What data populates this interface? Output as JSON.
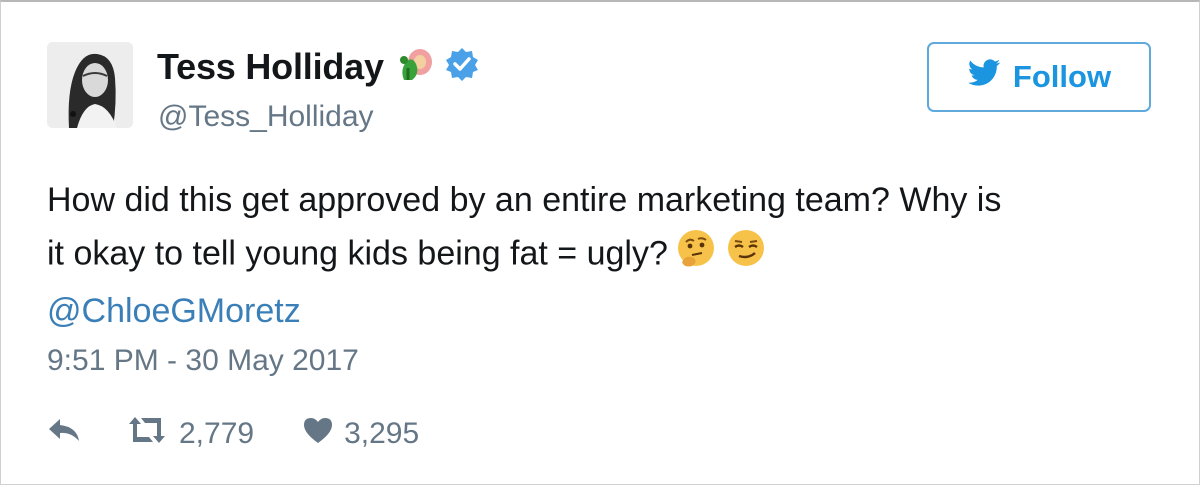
{
  "tweet": {
    "author": {
      "display_name": "Tess Holliday",
      "handle": "@Tess_Holliday",
      "name_emoji": "tiger/flower emoji",
      "verified": true
    },
    "follow_label": "Follow",
    "text_line1": "How did this get approved by an entire marketing team? Why is",
    "text_line2": "it okay to tell young kids being fat = ugly?",
    "mention": "@ChloeGMoretz",
    "timestamp": "9:51 PM - 30 May 2017",
    "retweets": "2,779",
    "likes": "3,295"
  },
  "icons": {
    "follow_icon": "twitter-bird-icon",
    "reply_icon": "reply-icon",
    "retweet_icon": "retweet-icon",
    "like_icon": "heart-icon",
    "verified_icon": "verified-badge-icon",
    "emoji_1": "thinking-face-emoji",
    "emoji_2": "smirking-face-emoji"
  },
  "colors": {
    "follow_blue": "#1b95e0",
    "verified_blue": "#4aa1e8",
    "mention_blue": "#3b7fb8",
    "muted_gray": "#657786"
  }
}
